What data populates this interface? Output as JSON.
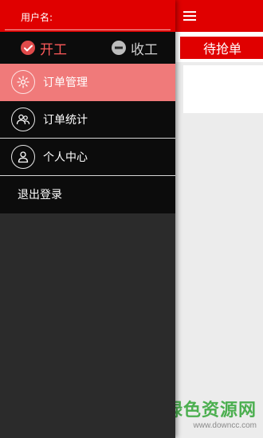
{
  "drawer": {
    "username_label": "用户名:",
    "status": {
      "on_label": "开工",
      "off_label": "收工"
    },
    "menu": [
      {
        "label": "订单管理",
        "icon": "gear-icon",
        "active": true
      },
      {
        "label": "订单统计",
        "icon": "users-icon",
        "active": false
      },
      {
        "label": "个人中心",
        "icon": "person-icon",
        "active": false
      }
    ],
    "logout_label": "退出登录"
  },
  "main": {
    "tab_label": "待抢单"
  },
  "watermark": {
    "title": "绿色资源网",
    "url": "www.downcc.com"
  },
  "colors": {
    "brand_red": "#e00000",
    "active_item": "#f07a7a",
    "drawer_bg": "#2b2b2b",
    "watermark_green": "#4caf50"
  }
}
